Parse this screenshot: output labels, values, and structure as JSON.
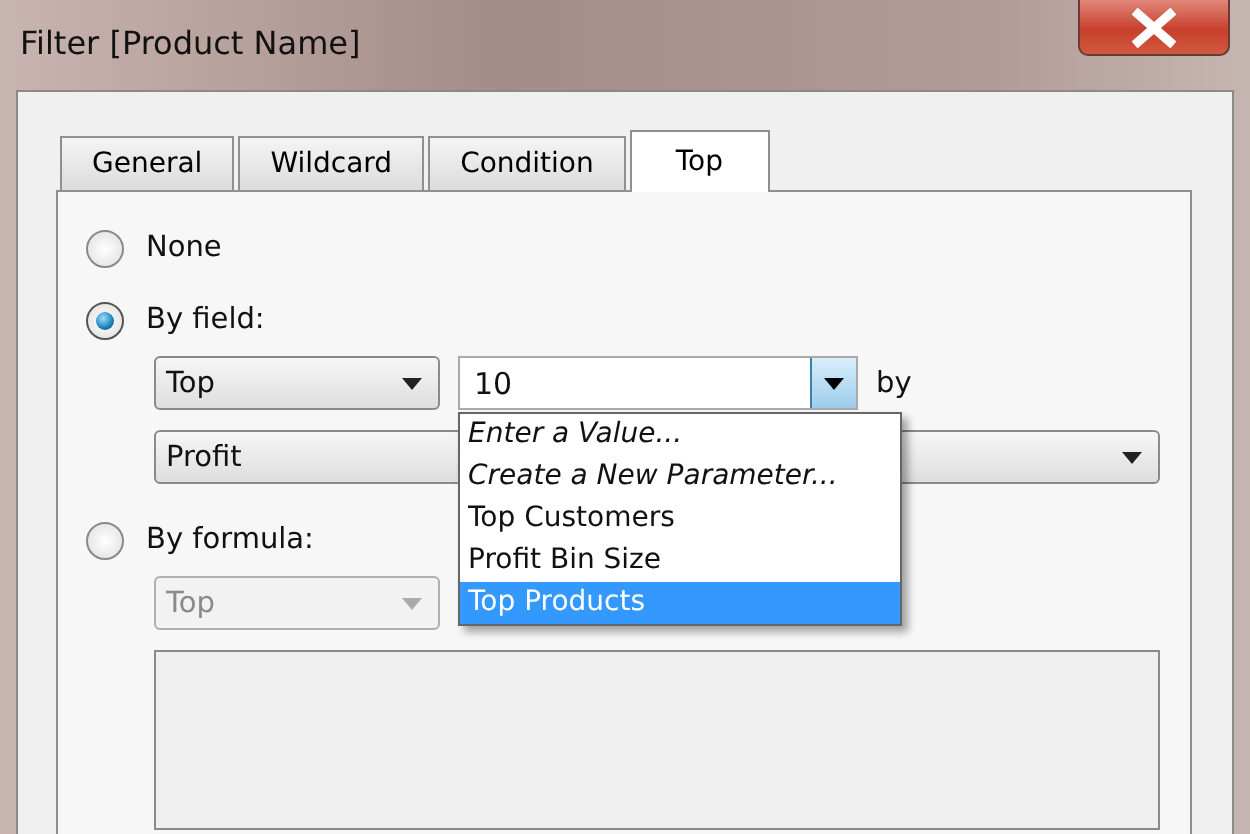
{
  "window": {
    "title": "Filter [Product Name]"
  },
  "tabs": [
    {
      "label": "General",
      "selected": false
    },
    {
      "label": "Wildcard",
      "selected": false
    },
    {
      "label": "Condition",
      "selected": false
    },
    {
      "label": "Top",
      "selected": true
    }
  ],
  "radios": [
    {
      "label": "None",
      "selected": false
    },
    {
      "label": "By field:",
      "selected": true
    },
    {
      "label": "By formula:",
      "selected": false
    }
  ],
  "by_field": {
    "direction": "Top",
    "count": "10",
    "by_label": "by",
    "field": "Profit",
    "count_menu": [
      {
        "label": "Enter a Value...",
        "italic": true,
        "selected": false
      },
      {
        "label": "Create a New Parameter...",
        "italic": true,
        "selected": false
      },
      {
        "label": "Top Customers",
        "italic": false,
        "selected": false
      },
      {
        "label": "Profit Bin Size",
        "italic": false,
        "selected": false
      },
      {
        "label": "Top Products",
        "italic": false,
        "selected": true
      }
    ]
  },
  "by_formula": {
    "direction": "Top",
    "disabled": true
  }
}
